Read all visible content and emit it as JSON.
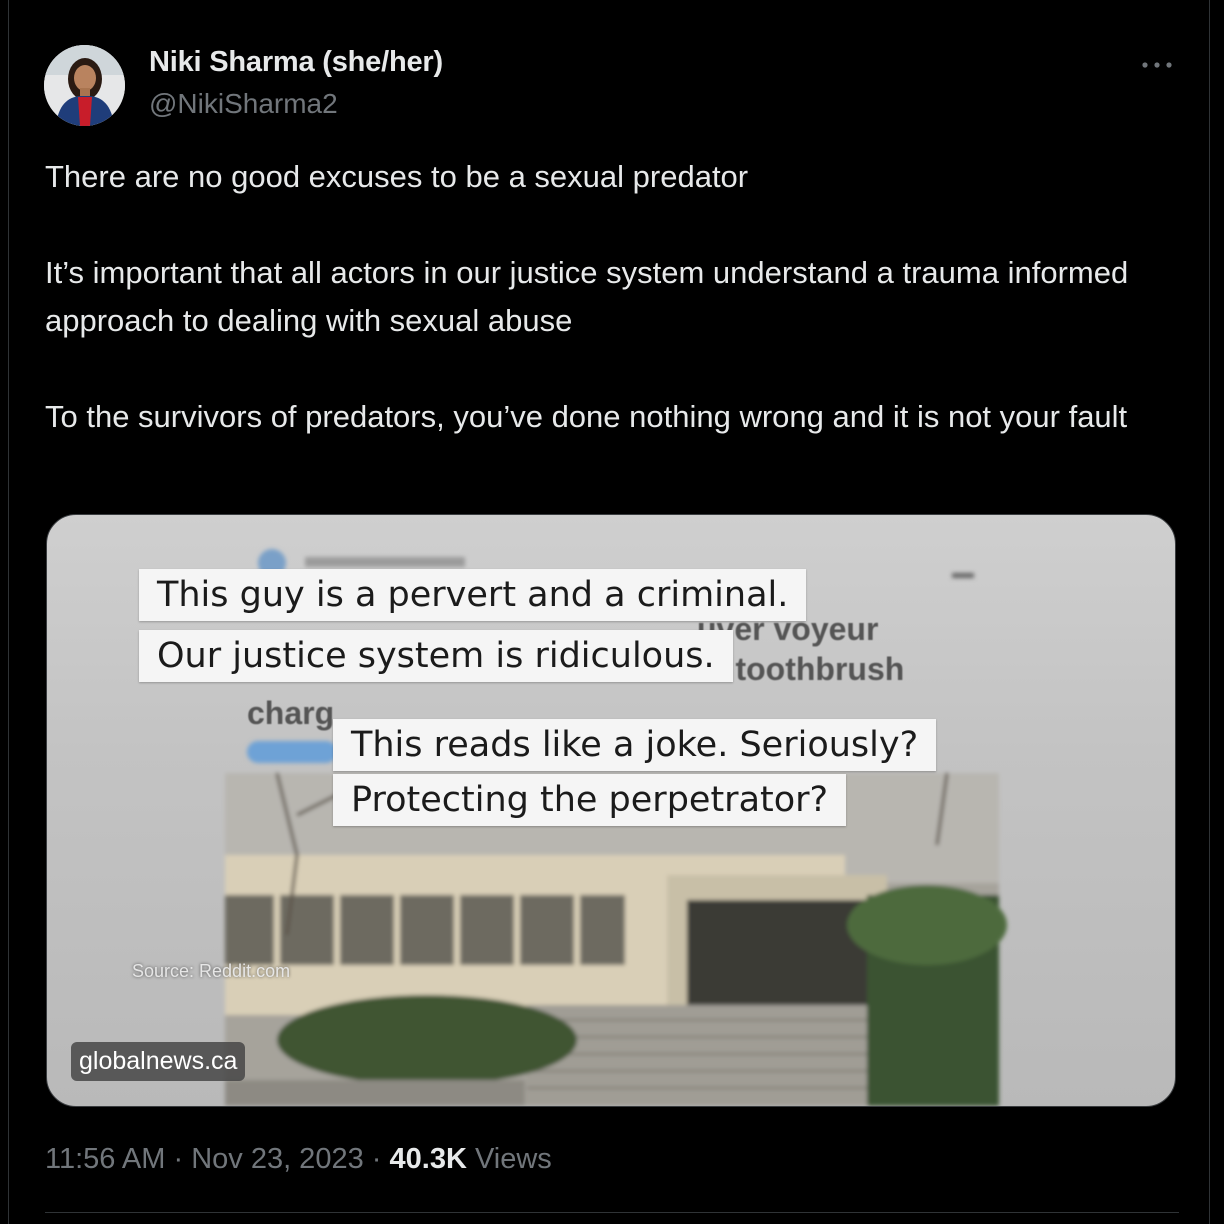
{
  "author": {
    "display_name": "Niki Sharma (she/her)",
    "handle": "@NikiSharma2"
  },
  "tweet": {
    "paragraphs": [
      "There are no good excuses to be a sexual predator",
      "It’s important that all actors in our justice system understand a trauma informed approach to dealing with sexual abuse",
      "To the survivors of predators, you’ve done nothing wrong and it is not your fault"
    ]
  },
  "media": {
    "captions": [
      "This guy is a pervert and a criminal.",
      "Our justice system is ridiculous.",
      "This reads like a joke. Seriously?",
      "Protecting the perpetrator?"
    ],
    "background_fragments": [
      "uver voyeur",
      "n toothbrush",
      "charg"
    ],
    "source_label": "Source: Reddit.com",
    "link_domain": "globalnews.ca"
  },
  "meta": {
    "time": "11:56 AM",
    "separator": "·",
    "date": "Nov 23, 2023",
    "views_count": "40.3K",
    "views_label": "Views"
  },
  "icons": {
    "more": "more-horizontal-icon"
  },
  "colors": {
    "background": "#000000",
    "text_primary": "#e7e9ea",
    "text_secondary": "#71767b"
  }
}
